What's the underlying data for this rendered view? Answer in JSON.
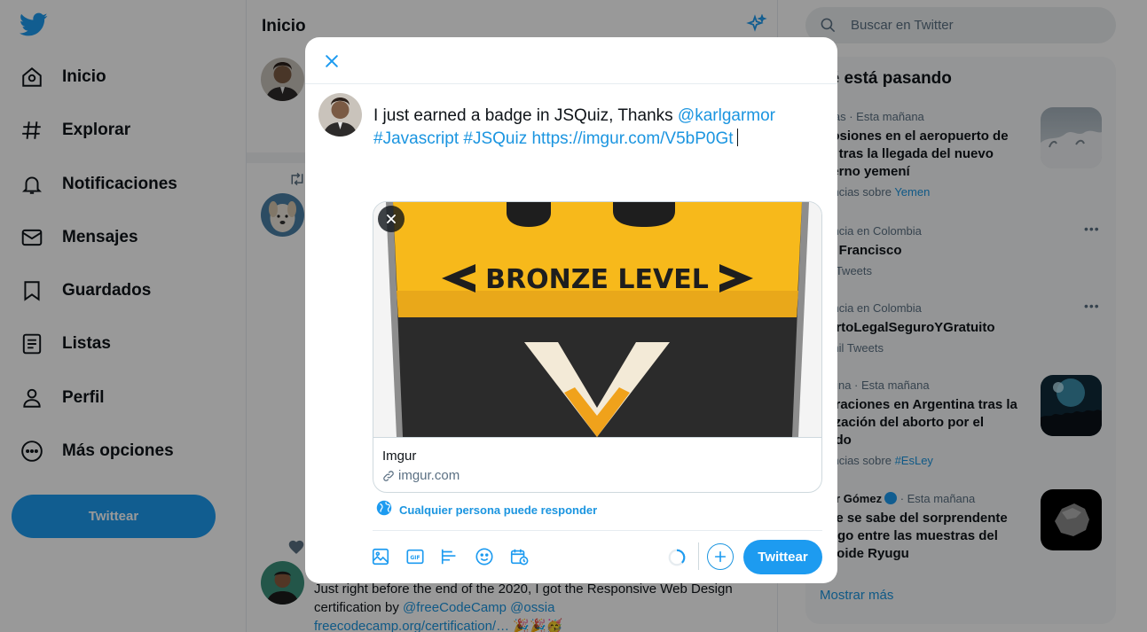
{
  "colors": {
    "brand": "#1d9bf0",
    "link": "#1b95e0",
    "text": "#0f1419",
    "muted": "#5b7083"
  },
  "sidebar": {
    "logo_icon": "twitter-bird-icon",
    "items": [
      {
        "label": "Inicio",
        "icon": "home-icon"
      },
      {
        "label": "Explorar",
        "icon": "hashtag-icon"
      },
      {
        "label": "Notificaciones",
        "icon": "bell-icon"
      },
      {
        "label": "Mensajes",
        "icon": "envelope-icon"
      },
      {
        "label": "Guardados",
        "icon": "bookmark-icon"
      },
      {
        "label": "Listas",
        "icon": "list-icon"
      },
      {
        "label": "Perfil",
        "icon": "person-icon"
      },
      {
        "label": "Más opciones",
        "icon": "more-circle-icon"
      }
    ],
    "tweet_button": "Twittear"
  },
  "feed": {
    "title": "Inicio",
    "tweet_text": "Just right before the end of the 2020, I got the Responsive Web Design certification by ",
    "mention_1": "@freeCodeCamp",
    "mention_2": "@ossia",
    "link": "freecodecamp.org/certification/…",
    "emoji": "🎉🎉🥳"
  },
  "search": {
    "placeholder": "Buscar en Twitter"
  },
  "trends": {
    "title": "ué está pasando",
    "items": [
      {
        "meta": "ticias · Esta mañana",
        "name": "plosiones en el aeropuerto de\nén tras la llegada del nuevo\nbierno yemení",
        "sub_prefix": "dencias sobre ",
        "sub_tag": "Yemen"
      },
      {
        "meta": "dencia en Colombia",
        "name": "pa Francisco",
        "sub_prefix": "47 Tweets",
        "sub_tag": ""
      },
      {
        "meta": "dencia en Colombia",
        "name": "bortoLegalSeguroYGratuito",
        "sub_prefix": "1 mil Tweets",
        "sub_tag": ""
      },
      {
        "meta": "entina · Esta mañana",
        "name": "ebraciones en Argentina tras la\nalización del aborto por el\nnado",
        "sub_prefix": "dencias sobre ",
        "sub_tag": "#EsLey"
      },
      {
        "meta_name": "Mar Gómez",
        "meta": " · Esta mañana",
        "name": "que se sabe del sorprendente\nlazgo entre las muestras del\nteroide Ryugu",
        "sub_prefix": "",
        "sub_tag": ""
      }
    ],
    "show_more": "Mostrar más"
  },
  "modal": {
    "close_icon": "close-icon",
    "text_plain": "I just earned a badge in JSQuiz, Thanks ",
    "mention": "@karlgarmor",
    "hashtag_1": "#Javascript",
    "hashtag_2": "#JSQuiz",
    "url": "https://imgur.com/V5bP0Gt",
    "card": {
      "image_text": "BRONZE LEVEL",
      "image_top_text": "JS",
      "site": "Imgur",
      "domain": "imgur.com"
    },
    "reply_setting": "Cualquier persona puede responder",
    "toolbar_icons": [
      "image-icon",
      "gif-icon",
      "poll-icon",
      "emoji-icon",
      "schedule-icon"
    ],
    "submit": "Twittear"
  }
}
